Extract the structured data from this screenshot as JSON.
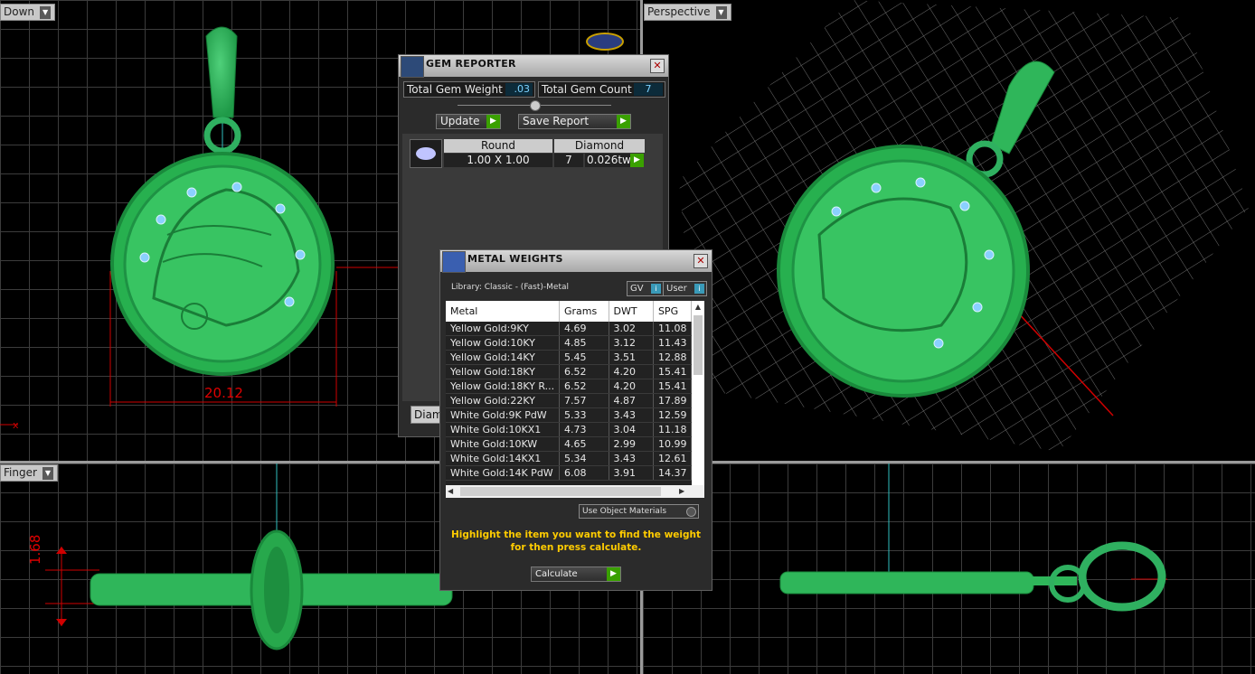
{
  "viewports": {
    "top_left_label": "Down",
    "top_right_label": "Perspective",
    "bottom_left_label": "Finger",
    "dimension_width": "20.12",
    "dimension_height": "1.68",
    "axis_marker": "x"
  },
  "gem_reporter": {
    "title": "GEM REPORTER",
    "total_weight_label": "Total Gem Weight",
    "total_weight_value": ".03",
    "total_count_label": "Total Gem Count",
    "total_count_value": "7",
    "update_label": "Update",
    "save_report_label": "Save Report",
    "header_shape": "Round",
    "header_material": "Diamond",
    "row_size": "1.00 X 1.00",
    "row_count": "7",
    "row_weight": "0.026tw",
    "tab_label": "Diamo"
  },
  "metal_weights": {
    "title": "METAL WEIGHTS",
    "library": "Library: Classic - (Fast)-Metal",
    "gv_label": "GV",
    "user_label": "User",
    "columns": [
      "Metal",
      "Grams",
      "DWT",
      "SPG"
    ],
    "rows": [
      [
        "Yellow Gold:9KY",
        "4.69",
        "3.02",
        "11.08"
      ],
      [
        "Yellow Gold:10KY",
        "4.85",
        "3.12",
        "11.43"
      ],
      [
        "Yellow Gold:14KY",
        "5.45",
        "3.51",
        "12.88"
      ],
      [
        "Yellow Gold:18KY",
        "6.52",
        "4.20",
        "15.41"
      ],
      [
        "Yellow Gold:18KY R...",
        "6.52",
        "4.20",
        "15.41"
      ],
      [
        "Yellow Gold:22KY",
        "7.57",
        "4.87",
        "17.89"
      ],
      [
        "White Gold:9K PdW",
        "5.33",
        "3.43",
        "12.59"
      ],
      [
        "White Gold:10KX1",
        "4.73",
        "3.04",
        "11.18"
      ],
      [
        "White Gold:10KW",
        "4.65",
        "2.99",
        "10.99"
      ],
      [
        "White Gold:14KX1",
        "5.34",
        "3.43",
        "12.61"
      ],
      [
        "White Gold:14K PdW",
        "6.08",
        "3.91",
        "14.37"
      ]
    ],
    "use_object_materials": "Use Object Materials",
    "instruction_line1": "Highlight the item you want to find the weight",
    "instruction_line2": "for then press calculate.",
    "calculate_label": "Calculate"
  }
}
